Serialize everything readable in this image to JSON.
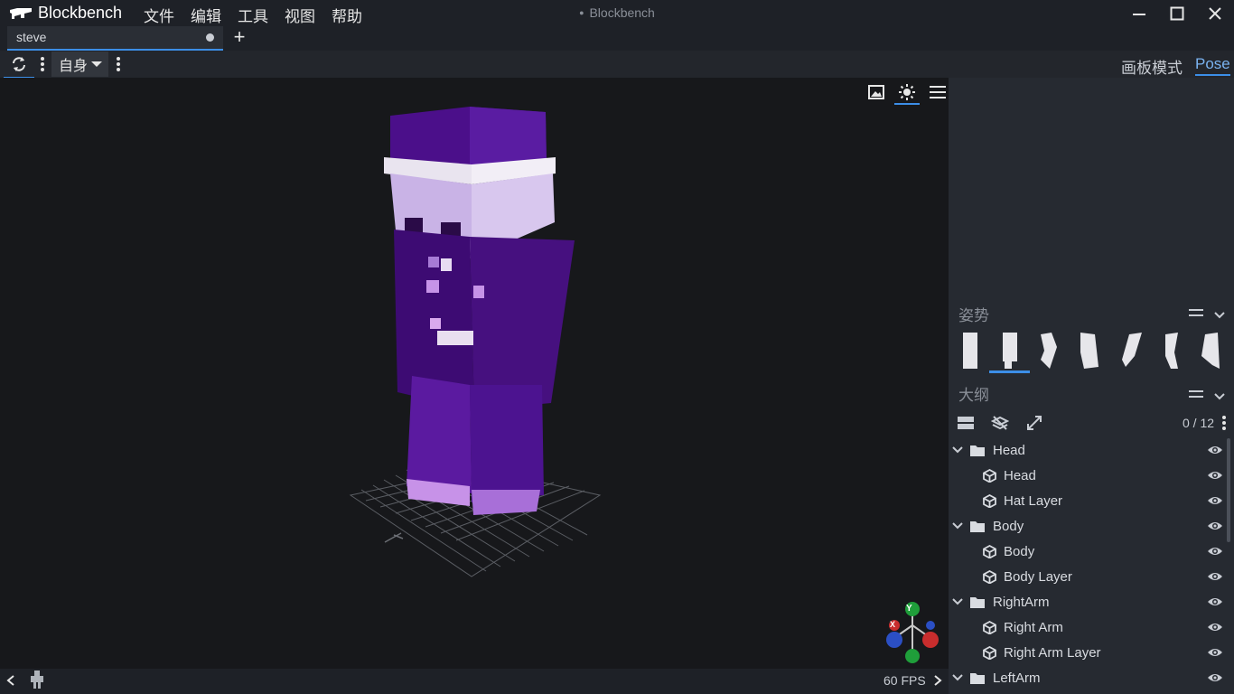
{
  "app": {
    "name": "Blockbench",
    "window_title": "Blockbench"
  },
  "menu": [
    "文件",
    "编辑",
    "工具",
    "视图",
    "帮助"
  ],
  "tabs": [
    {
      "label": "steve",
      "modified": true
    }
  ],
  "toolbar": {
    "space_label": "自身"
  },
  "modes": {
    "edit": "画板模式",
    "pose": "Pose"
  },
  "status": {
    "fps": "60 FPS"
  },
  "panels": {
    "pose": {
      "title": "姿势",
      "selected_index": 1,
      "count": 7
    },
    "outliner": {
      "title": "大纲",
      "counter": "0 / 12",
      "rows": [
        {
          "type": "group",
          "label": "Head"
        },
        {
          "type": "cube",
          "label": "Head"
        },
        {
          "type": "cube",
          "label": "Hat Layer"
        },
        {
          "type": "group",
          "label": "Body"
        },
        {
          "type": "cube",
          "label": "Body"
        },
        {
          "type": "cube",
          "label": "Body Layer"
        },
        {
          "type": "group",
          "label": "RightArm"
        },
        {
          "type": "cube",
          "label": "Right Arm"
        },
        {
          "type": "cube",
          "label": "Right Arm Layer"
        },
        {
          "type": "group",
          "label": "LeftArm"
        }
      ]
    }
  },
  "gizmo": {
    "y": "Y",
    "x": "X"
  },
  "colors": {
    "accent": "#3c8ee7",
    "viewport_bg": "#17181b",
    "panel_bg": "#262a31",
    "skin_purple": "#4b0f8a",
    "skin_lilac": "#c9b3e6"
  }
}
